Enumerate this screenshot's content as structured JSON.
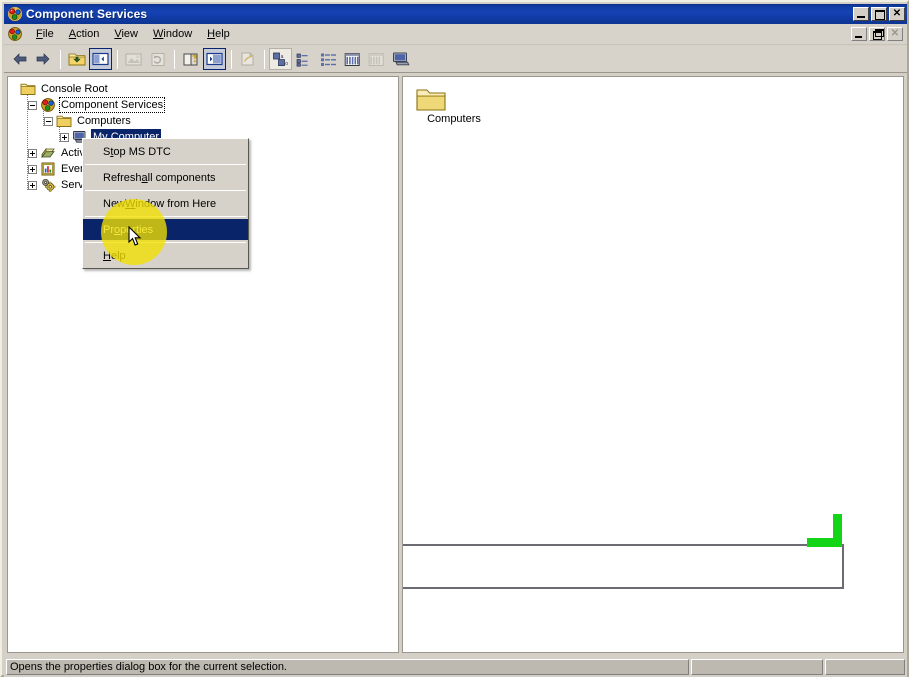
{
  "window": {
    "title": "Component Services",
    "icon": "component-services-icon",
    "controls": {
      "minimize": "–",
      "maximize": "❐",
      "close": "✕"
    },
    "mdi_controls": {
      "minimize": "–",
      "restore": "❐",
      "close": "✕"
    }
  },
  "menu_bar": {
    "items": [
      {
        "name": "file",
        "label": "File",
        "accel": "F"
      },
      {
        "name": "action",
        "label": "Action",
        "accel": "A"
      },
      {
        "name": "view",
        "label": "View",
        "accel": "V"
      },
      {
        "name": "window",
        "label": "Window",
        "accel": "W"
      },
      {
        "name": "help",
        "label": "Help",
        "accel": "H"
      }
    ]
  },
  "toolbar": {
    "buttons": [
      {
        "name": "back",
        "icon": "arrow-left-icon",
        "state": "normal"
      },
      {
        "name": "forward",
        "icon": "arrow-right-icon",
        "state": "normal"
      },
      {
        "sep": true
      },
      {
        "name": "up-one-level",
        "icon": "up-folder-icon",
        "state": "normal"
      },
      {
        "name": "show-hide-console-tree",
        "icon": "tree-pane-icon",
        "state": "pressed"
      },
      {
        "sep": true
      },
      {
        "name": "export-list",
        "icon": "export-list-icon",
        "state": "disabled"
      },
      {
        "name": "refresh",
        "icon": "refresh-icon",
        "state": "disabled"
      },
      {
        "sep": true
      },
      {
        "name": "help-topics",
        "icon": "help-book-icon",
        "state": "normal"
      },
      {
        "name": "show-hide-tree-2",
        "icon": "tree-pane-2-icon",
        "state": "pressed"
      },
      {
        "sep": true
      },
      {
        "name": "new-window-from-here",
        "icon": "new-window-icon",
        "state": "disabled"
      },
      {
        "sep": true
      },
      {
        "name": "large-icons",
        "icon": "large-icons-icon",
        "state": "pressed2"
      },
      {
        "name": "small-icons",
        "icon": "small-icons-icon",
        "state": "normal"
      },
      {
        "name": "list-view",
        "icon": "list-view-icon",
        "state": "normal"
      },
      {
        "name": "details-view",
        "icon": "details-view-icon",
        "state": "normal"
      },
      {
        "name": "filter-view",
        "icon": "filter-view-icon",
        "state": "disabled"
      },
      {
        "name": "my-computer",
        "icon": "computer-icon",
        "state": "normal"
      }
    ]
  },
  "tree": {
    "nodes": [
      {
        "name": "console-root",
        "label": "Console Root",
        "icon": "folder-open-icon",
        "indent": 0,
        "expander": "none",
        "state": "normal"
      },
      {
        "name": "component-services",
        "label": "Component Services",
        "icon": "component-services-icon",
        "indent": 1,
        "expander": "minus",
        "state": "focus"
      },
      {
        "name": "computers",
        "label": "Computers",
        "icon": "folder-icon",
        "indent": 2,
        "expander": "minus",
        "state": "normal"
      },
      {
        "name": "my-computer",
        "label": "My Computer",
        "icon": "computer-icon",
        "indent": 3,
        "expander": "plus",
        "state": "selected"
      },
      {
        "name": "active-directory",
        "label": "Active Directory Users and Computers",
        "icon": "active-directory-icon",
        "indent": 1,
        "expander": "plus",
        "state": "normal"
      },
      {
        "name": "event-viewer",
        "label": "Event Viewer (Local)",
        "icon": "event-viewer-icon",
        "indent": 1,
        "expander": "plus",
        "state": "normal"
      },
      {
        "name": "services",
        "label": "Services (Local)",
        "icon": "services-icon",
        "indent": 1,
        "expander": "plus",
        "state": "normal"
      }
    ]
  },
  "list_pane": {
    "items": [
      {
        "name": "computers-folder",
        "label": "Computers",
        "icon": "folder-icon"
      }
    ]
  },
  "context_menu": {
    "items": [
      {
        "name": "stop-ms-dtc",
        "label": "Stop MS DTC",
        "accel": "t",
        "highlighted": false
      },
      {
        "sep": true
      },
      {
        "name": "refresh-all-components",
        "label": "Refresh all components",
        "accel": "a",
        "highlighted": false
      },
      {
        "sep": true
      },
      {
        "name": "new-window-from-here",
        "label": "New Window from Here",
        "accel": "W",
        "highlighted": false
      },
      {
        "sep": true
      },
      {
        "name": "properties",
        "label": "Properties",
        "accel": "o",
        "highlighted": true
      },
      {
        "sep": true
      },
      {
        "name": "help",
        "label": "Help",
        "accel": "H",
        "highlighted": false
      }
    ]
  },
  "status_bar": {
    "main": "Opens the properties dialog box for the current selection.",
    "middle": "",
    "right": ""
  },
  "colors": {
    "title_bar": "#0f3a9e",
    "selection": "#0a246a",
    "face": "#d4d0c8",
    "halo": "#f2e000",
    "artifact_green": "#13d417",
    "artifact_gray": "#6d6a73"
  }
}
